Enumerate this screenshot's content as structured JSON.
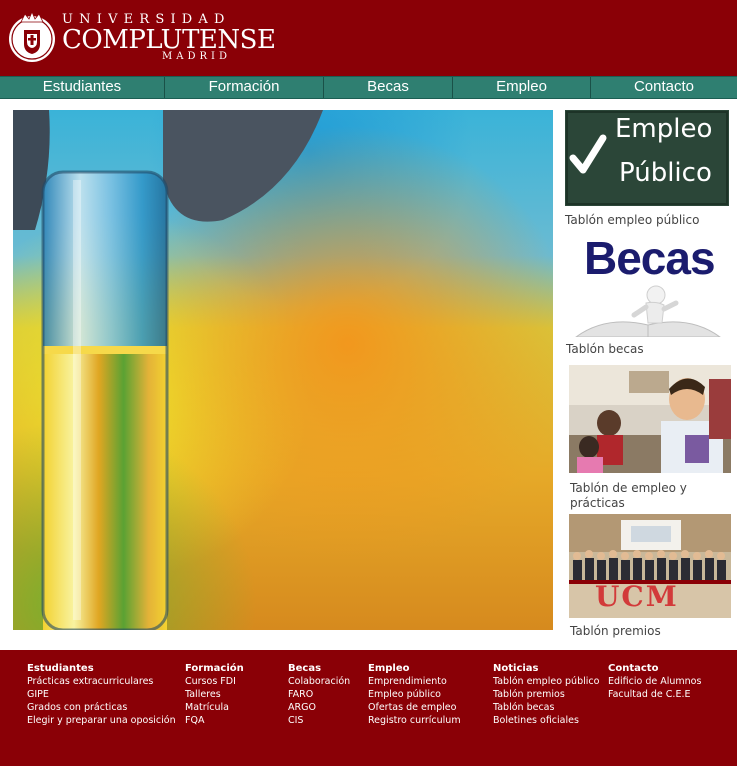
{
  "header": {
    "logo_top": "UNIVERSIDAD",
    "logo_main": "COMPLUTENSE",
    "logo_bottom": "MADRID",
    "brand_color": "#8a0006"
  },
  "nav": {
    "color": "#2f7f71",
    "items": [
      "Estudiantes",
      "Formación",
      "Becas",
      "Empleo",
      "Contacto"
    ]
  },
  "sidebar": {
    "cards": [
      {
        "image_text_1": "Empleo",
        "image_text_2": "Público",
        "caption": "Tablón empleo público"
      },
      {
        "image_text_1": "Becas",
        "caption": "Tablón becas"
      },
      {
        "caption": "Tablón de empleo y prácticas"
      },
      {
        "image_text_1": "UCM",
        "caption": "Tablón premios"
      }
    ]
  },
  "footer": {
    "columns": [
      {
        "heading": "Estudiantes",
        "links": [
          "Prácticas extracurriculares",
          "GIPE",
          "Grados con prácticas",
          "Elegir y preparar una oposición"
        ]
      },
      {
        "heading": "Formación",
        "links": [
          "Cursos FDI",
          "Talleres",
          "Matrícula",
          "FQA"
        ]
      },
      {
        "heading": "Becas",
        "links": [
          "Colaboración",
          "FARO",
          "ARGO",
          "CIS"
        ]
      },
      {
        "heading": "Empleo",
        "links": [
          "Emprendimiento",
          "Empleo público",
          "Ofertas de empleo",
          "Registro currículum"
        ]
      },
      {
        "heading": "Noticias",
        "links": [
          "Tablón empleo público",
          "Tablón premios",
          "Tablón becas",
          "Boletines oficiales"
        ]
      },
      {
        "heading": "Contacto",
        "links": [
          "Edificio de Alumnos",
          "Facultad de C.E.E"
        ]
      }
    ]
  }
}
